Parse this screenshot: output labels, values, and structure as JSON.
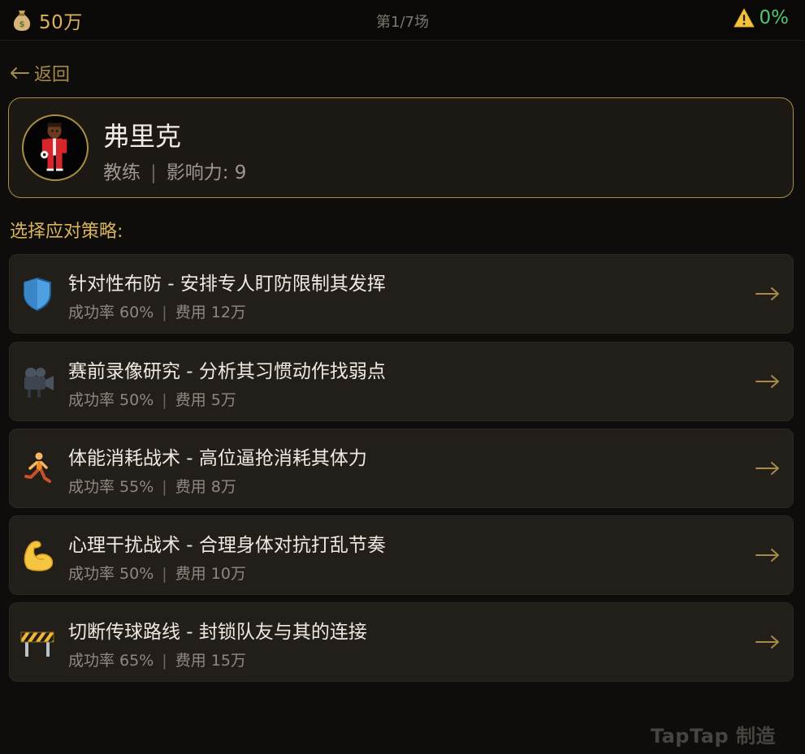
{
  "status": {
    "money": "50万",
    "money_icon": "money-bag-icon",
    "round": "第1/7场",
    "risk": "0%",
    "risk_icon": "warning-icon"
  },
  "nav": {
    "back_label": "返回"
  },
  "player": {
    "name": "弗里克",
    "role": "教练",
    "influence": "影响力: 9",
    "separator": "|"
  },
  "section_title": "选择应对策略:",
  "options": [
    {
      "title": "针对性布防 - 安排专人盯防限制其发挥",
      "success": "成功率 60%",
      "cost": "费用 12万",
      "icon": "shield-icon"
    },
    {
      "title": "赛前录像研究 - 分析其习惯动作找弱点",
      "success": "成功率 50%",
      "cost": "费用 5万",
      "icon": "video-camera-icon"
    },
    {
      "title": "体能消耗战术 - 高位逼抢消耗其体力",
      "success": "成功率 55%",
      "cost": "费用 8万",
      "icon": "runner-icon"
    },
    {
      "title": "心理干扰战术 - 合理身体对抗打乱节奏",
      "success": "成功率 50%",
      "cost": "费用 10万",
      "icon": "flexed-bicep-icon"
    },
    {
      "title": "切断传球路线 - 封锁队友与其的连接",
      "success": "成功率 65%",
      "cost": "费用 15万",
      "icon": "barrier-icon"
    }
  ],
  "sub_separator": "|",
  "watermark": "TapTap 制造",
  "colors": {
    "accent": "#d9b45a",
    "border": "#a98f44",
    "positive": "#4fc76f",
    "card": "#221e1a",
    "background": "#0f0d0b"
  }
}
